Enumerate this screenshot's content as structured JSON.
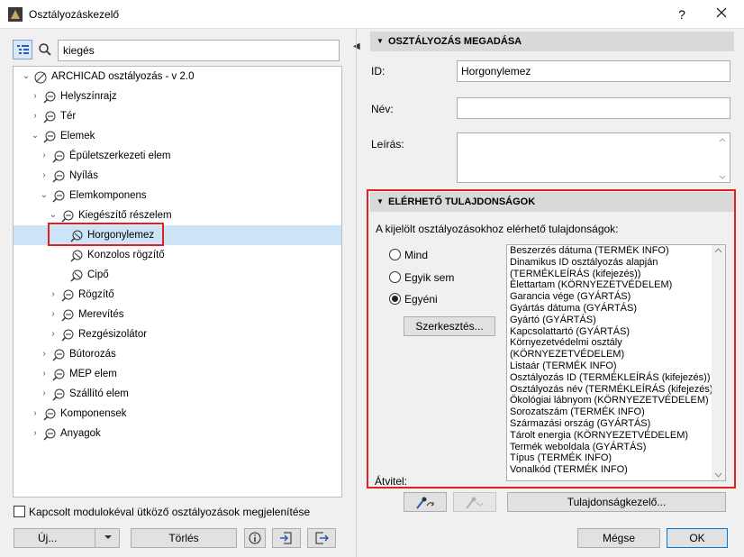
{
  "window": {
    "title": "Osztályozáskezelő",
    "help": "?"
  },
  "search": {
    "value": "kiegés"
  },
  "tree": [
    {
      "label": "ARCHICAD osztályozás - v 2.0",
      "level": 0,
      "chevron": "open",
      "icon": "classification-system-icon"
    },
    {
      "label": "Helyszínrajz",
      "level": 1,
      "chevron": "closed",
      "icon": "class-icon"
    },
    {
      "label": "Tér",
      "level": 1,
      "chevron": "closed",
      "icon": "class-icon"
    },
    {
      "label": "Elemek",
      "level": 1,
      "chevron": "open",
      "icon": "class-icon"
    },
    {
      "label": "Épületszerkezeti elem",
      "level": 2,
      "chevron": "closed",
      "icon": "class-icon"
    },
    {
      "label": "Nyílás",
      "level": 2,
      "chevron": "closed",
      "icon": "class-icon"
    },
    {
      "label": "Elemkomponens",
      "level": 2,
      "chevron": "open",
      "icon": "class-icon"
    },
    {
      "label": "Kiegészítő részelem",
      "level": 3,
      "chevron": "open",
      "icon": "class-icon"
    },
    {
      "label": "Horgonylemez",
      "level": 4,
      "chevron": "none",
      "icon": "class-leaf-icon",
      "selected": true
    },
    {
      "label": "Konzolos rögzítő",
      "level": 4,
      "chevron": "none",
      "icon": "class-leaf-icon"
    },
    {
      "label": "Cipő",
      "level": 4,
      "chevron": "none",
      "icon": "class-leaf-icon"
    },
    {
      "label": "Rögzítő",
      "level": 3,
      "chevron": "closed",
      "icon": "class-icon"
    },
    {
      "label": "Merevítés",
      "level": 3,
      "chevron": "closed",
      "icon": "class-icon"
    },
    {
      "label": "Rezgésizolátor",
      "level": 3,
      "chevron": "closed",
      "icon": "class-icon"
    },
    {
      "label": "Bútorozás",
      "level": 2,
      "chevron": "closed",
      "icon": "class-icon"
    },
    {
      "label": "MEP elem",
      "level": 2,
      "chevron": "closed",
      "icon": "class-icon"
    },
    {
      "label": "Szállító elem",
      "level": 2,
      "chevron": "closed",
      "icon": "class-icon"
    },
    {
      "label": "Komponensek",
      "level": 1,
      "chevron": "closed",
      "icon": "class-icon"
    },
    {
      "label": "Anyagok",
      "level": 1,
      "chevron": "closed",
      "icon": "class-icon"
    }
  ],
  "left_footer": {
    "conflict_label": "Kapcsolt modulokéval ütköző osztályozások megjelenítése",
    "new_label": "Új...",
    "delete_label": "Törlés"
  },
  "definition": {
    "header": "OSZTÁLYOZÁS MEGADÁSA",
    "id_label": "ID:",
    "id_value": "Horgonylemez",
    "name_label": "Név:",
    "name_value": "",
    "desc_label": "Leírás:",
    "desc_value": ""
  },
  "properties": {
    "header": "ELÉRHETŐ TULAJDONSÁGOK",
    "intro": "A kijelölt osztályozásokhoz elérhető tulajdonságok:",
    "radio_all": "Mind",
    "radio_none": "Egyik sem",
    "radio_custom": "Egyéni",
    "selected_radio": "custom",
    "edit_label": "Szerkesztés...",
    "items": [
      "Beszerzés dátuma (TERMÉK INFO)",
      "Dinamikus ID osztályozás alapján",
      "(TERMÉKLEÍRÁS (kifejezés))",
      "Élettartam (KÖRNYEZETVÉDELEM)",
      "Garancia vége (GYÁRTÁS)",
      "Gyártás dátuma (GYÁRTÁS)",
      "Gyártó (GYÁRTÁS)",
      "Kapcsolattartó (GYÁRTÁS)",
      "Környezetvédelmi osztály",
      "(KÖRNYEZETVÉDELEM)",
      "Listaár (TERMÉK INFO)",
      "Osztályozás ID (TERMÉKLEÍRÁS (kifejezés))",
      "Osztályozás név (TERMÉKLEÍRÁS (kifejezés))",
      "Ökológiai lábnyom (KÖRNYEZETVÉDELEM)",
      "Sorozatszám (TERMÉK INFO)",
      "Származási ország (GYÁRTÁS)",
      "Tárolt energia (KÖRNYEZETVÉDELEM)",
      "Termék weboldala (GYÁRTÁS)",
      "Típus (TERMÉK INFO)",
      "Vonalkód (TERMÉK INFO)"
    ],
    "transfer_label": "Átvitel:",
    "propmgr_label": "Tulajdonságkezelő..."
  },
  "footer": {
    "cancel_label": "Mégse",
    "ok_label": "OK"
  },
  "colors": {
    "highlight": "#e0201f",
    "selection": "#cce4f7"
  }
}
